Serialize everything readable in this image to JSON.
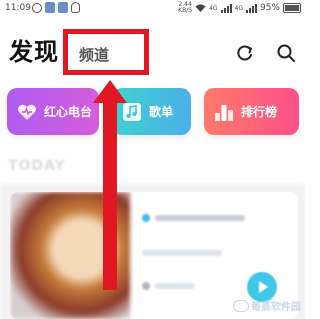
{
  "status_bar": {
    "time": "11:09",
    "net_speed_value": "2.44",
    "net_speed_unit": "KB/S",
    "net_type": "4G",
    "net_type_2": "4G",
    "battery": "95%"
  },
  "header": {
    "title": "发现",
    "channel_label": "频道"
  },
  "cards": [
    {
      "label": "红心电台"
    },
    {
      "label": "歌单"
    },
    {
      "label": "排行榜"
    }
  ],
  "feed": {
    "section_label": "TODAY"
  },
  "watermark": {
    "text": "每蒸软件园"
  },
  "colors": {
    "highlight": "#e01823",
    "radio_card": "#b05cf0",
    "songs_card": "#3fd0d0",
    "charts_card": "#ff5a7a"
  },
  "icons": [
    "alarm-icon",
    "qq-icon",
    "wifi-icon",
    "signal-icon",
    "battery-icon",
    "refresh-icon",
    "search-icon",
    "heart-icon",
    "music-note-icon",
    "ranking-icon",
    "play-icon"
  ]
}
